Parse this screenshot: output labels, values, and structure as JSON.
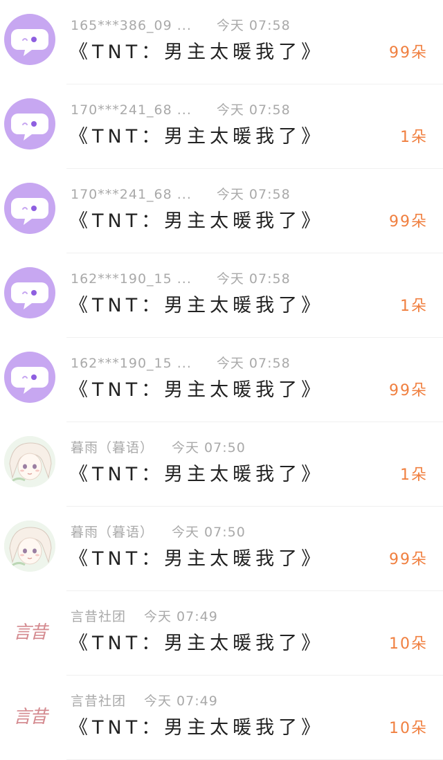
{
  "colors": {
    "accent": "#f07f3f",
    "avatar_purple": "#c7a7f1",
    "meta_text": "#a9a9a9",
    "message_text": "#222222"
  },
  "list": {
    "items": [
      {
        "username": "165***386_09 ...",
        "time": "今天 07:58",
        "message": "《TNT：男主太暖我了》",
        "count": "99朵",
        "avatar": "chat-bubble-avatar-icon"
      },
      {
        "username": "170***241_68 ...",
        "time": "今天 07:58",
        "message": "《TNT：男主太暖我了》",
        "count": "1朵",
        "avatar": "chat-bubble-avatar-icon"
      },
      {
        "username": "170***241_68 ...",
        "time": "今天 07:58",
        "message": "《TNT：男主太暖我了》",
        "count": "99朵",
        "avatar": "chat-bubble-avatar-icon"
      },
      {
        "username": "162***190_15 ...",
        "time": "今天 07:58",
        "message": "《TNT：男主太暖我了》",
        "count": "1朵",
        "avatar": "chat-bubble-avatar-icon"
      },
      {
        "username": "162***190_15 ...",
        "time": "今天 07:58",
        "message": "《TNT：男主太暖我了》",
        "count": "99朵",
        "avatar": "chat-bubble-avatar-icon"
      },
      {
        "username": "暮雨（暮语）",
        "time": "今天 07:50",
        "message": "《TNT：男主太暖我了》",
        "count": "1朵",
        "avatar": "anime-girl-avatar"
      },
      {
        "username": "暮雨（暮语）",
        "time": "今天 07:50",
        "message": "《TNT：男主太暖我了》",
        "count": "99朵",
        "avatar": "anime-girl-avatar"
      },
      {
        "username": "言昔社团",
        "time": "今天 07:49",
        "message": "《TNT：男主太暖我了》",
        "count": "10朵",
        "avatar": "calligraphy-logo-avatar"
      },
      {
        "username": "言昔社团",
        "time": "今天 07:49",
        "message": "《TNT：男主太暖我了》",
        "count": "10朵",
        "avatar": "calligraphy-logo-avatar"
      }
    ]
  },
  "logo_text": "言昔"
}
